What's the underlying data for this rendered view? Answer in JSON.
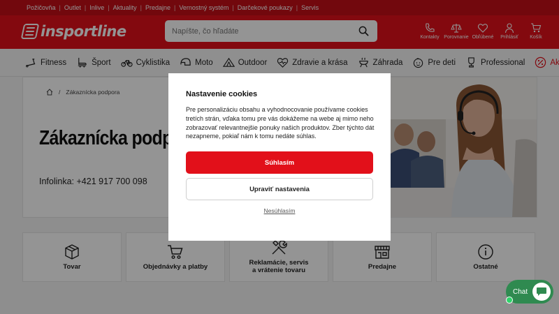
{
  "topbar": {
    "links": [
      "Požičovňa",
      "Outlet",
      "Inlive",
      "Aktuality",
      "Predajne",
      "Vernostný systém",
      "Darčekové poukazy",
      "Servis"
    ]
  },
  "header": {
    "logo_text": "insportline",
    "search_placeholder": "Napíšte, čo hľadáte",
    "icons": [
      {
        "label": "Kontakty",
        "icon": "phone-icon"
      },
      {
        "label": "Porovnanie",
        "icon": "compare-icon"
      },
      {
        "label": "Obľúbené",
        "icon": "heart-icon"
      },
      {
        "label": "Prihlásiť",
        "icon": "user-icon"
      },
      {
        "label": "Košík",
        "icon": "cart-icon"
      }
    ]
  },
  "nav": {
    "items": [
      "Fitness",
      "Šport",
      "Cyklistika",
      "Moto",
      "Outdoor",
      "Zdravie a krása",
      "Záhrada",
      "Pre deti",
      "Professional",
      "Akcie"
    ]
  },
  "breadcrumb": {
    "current": "Zákaznícka podpora"
  },
  "page": {
    "title": "Zákaznícka podpora",
    "infoline": "Infolinka: +421 917 700 098"
  },
  "tiles": [
    {
      "label": "Tovar",
      "icon": "box-icon"
    },
    {
      "label": "Objednávky a platby",
      "icon": "cart-icon"
    },
    {
      "label": "Reklamácie, servis\na vrátenie tovaru",
      "icon": "tools-icon"
    },
    {
      "label": "Predajne",
      "icon": "store-icon"
    },
    {
      "label": "Ostatné",
      "icon": "info-icon"
    }
  ],
  "cookie_modal": {
    "title": "Nastavenie cookies",
    "text": "Pre personalizáciu obsahu a vyhodnocovanie používame cookies tretích strán, vďaka tomu pre vás dokážeme na webe aj mimo neho zobrazovať relevantnejšie ponuky našich produktov. Zber týchto dát nezapneme, pokiaľ nám k tomu nedáte súhlas.",
    "accept": "Súhlasím",
    "settings": "Upraviť nastavenia",
    "decline": "Nesúhlasím"
  },
  "chat": {
    "label": "Chat"
  },
  "colors": {
    "brand": "#e2101a",
    "topbar": "#c40f17",
    "chat": "#2f8a50"
  }
}
